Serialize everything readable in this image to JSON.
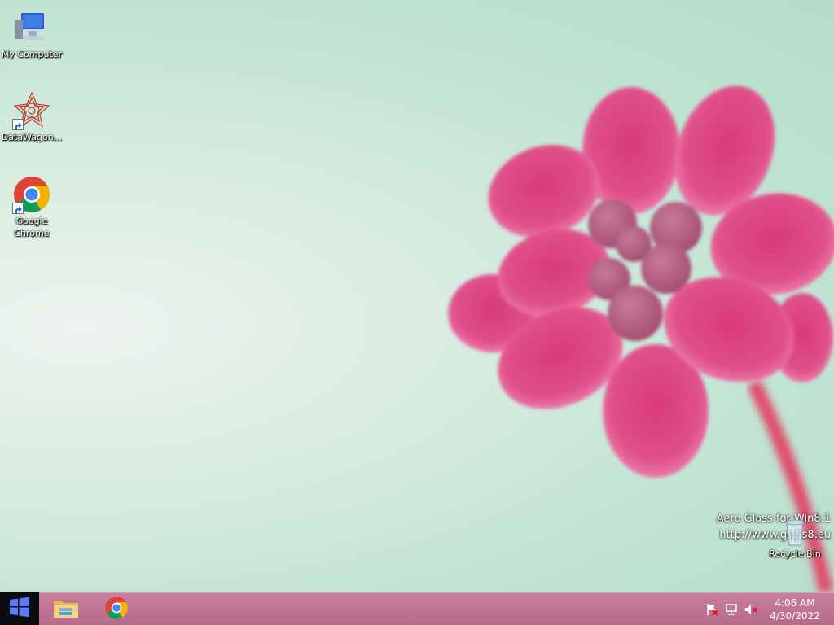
{
  "desktop_icons": [
    {
      "label": "My Computer",
      "icon": "my-computer-icon"
    },
    {
      "label": "DataWagon...",
      "icon": "datawagon-icon"
    },
    {
      "label": "Google Chrome",
      "icon": "chrome-icon"
    }
  ],
  "recycle_bin": {
    "label": "Recycle Bin",
    "icon": "recycle-bin-icon"
  },
  "watermark": {
    "line1": "Aero Glass for Win8.1",
    "line2": "http://www.glass8.eu"
  },
  "taskbar": {
    "start_icon": "windows-logo-icon",
    "pinned": [
      {
        "name": "File Explorer",
        "icon": "folder-icon"
      },
      {
        "name": "Google Chrome",
        "icon": "chrome-icon"
      }
    ],
    "tray_icons": [
      "action-center-flag-icon",
      "network-icon",
      "volume-muted-icon"
    ],
    "clock": {
      "time": "4:06 AM",
      "date": "4/30/2022"
    }
  },
  "colors": {
    "taskbar": "#b66a8b",
    "start_button": "#0b0b12",
    "wallpaper": "#bfe3d2",
    "flower": "#e0457f"
  }
}
